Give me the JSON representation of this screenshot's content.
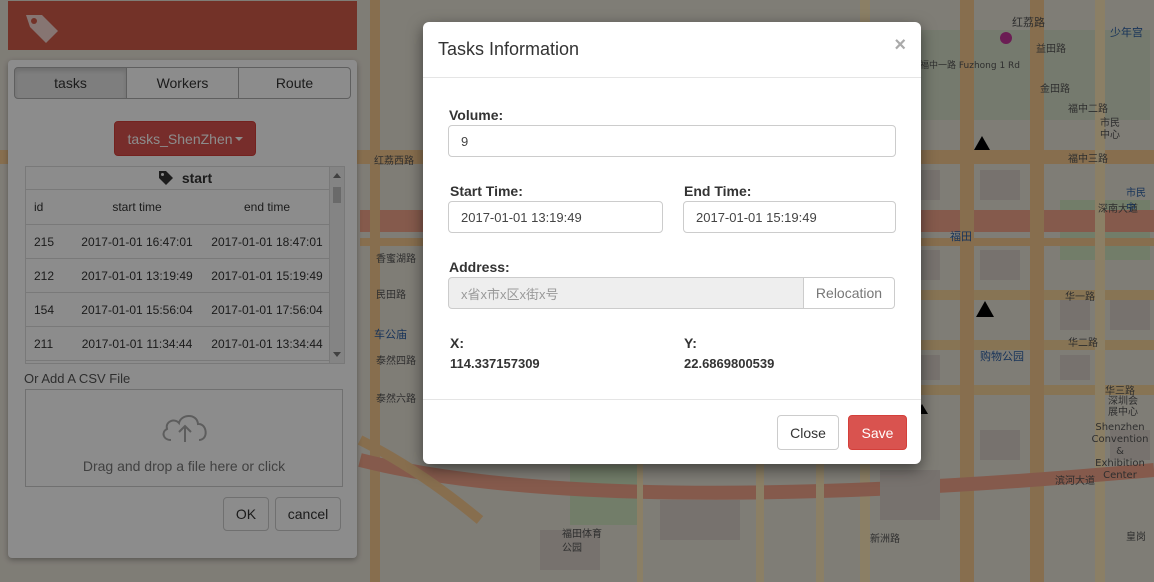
{
  "left_panel": {
    "tabs": [
      {
        "label": "tasks"
      },
      {
        "label": "Workers"
      },
      {
        "label": "Route"
      }
    ],
    "dataset_button": "tasks_ShenZhen",
    "table": {
      "title": "start",
      "headers": [
        "id",
        "start time",
        "end time"
      ],
      "rows": [
        {
          "id": "215",
          "start": "2017-01-01 16:47:01",
          "end": "2017-01-01 18:47:01"
        },
        {
          "id": "212",
          "start": "2017-01-01 13:19:49",
          "end": "2017-01-01 15:19:49"
        },
        {
          "id": "154",
          "start": "2017-01-01 15:56:04",
          "end": "2017-01-01 17:56:04"
        },
        {
          "id": "211",
          "start": "2017-01-01 11:34:44",
          "end": "2017-01-01 13:34:44"
        }
      ]
    },
    "csv_label": "Or Add A CSV File",
    "dropzone_text": "Drag and drop a file here or click",
    "ok_label": "OK",
    "cancel_label": "cancel"
  },
  "modal": {
    "title": "Tasks Information",
    "close_glyph": "×",
    "volume_label": "Volume:",
    "volume_value": "9",
    "start_label": "Start Time:",
    "start_value": "2017-01-01 13:19:49",
    "end_label": "End Time:",
    "end_value": "2017-01-01 15:19:49",
    "address_label": "Address:",
    "address_placeholder": "x省x市x区x街x号",
    "relocation_label": "Relocation",
    "x_label": "X:",
    "x_value": "114.337157309",
    "y_label": "Y:",
    "y_value": "22.6869800539",
    "close_label": "Close",
    "save_label": "Save"
  },
  "map": {
    "labels": [
      "红荔路",
      "少年宫",
      "福中一路 Fuzhong 1 Rd",
      "市民中心",
      "福中三路",
      "福中二路",
      "深南大道",
      "福田",
      "华一路",
      "购物公园",
      "华二路",
      "华三路",
      "深圳会展中心",
      "Shenzhen Convention & Exhibition Center",
      "滨河大道",
      "福田体育公园",
      "车公庙",
      "泰然四路",
      "泰然六路",
      "红荔西路",
      "香蜜湖路",
      "民田路",
      "益田路",
      "金田路",
      "新洲路",
      "皇岗",
      "市民中"
    ]
  },
  "colors": {
    "accent_red": "#d9534f",
    "topbar": "#d25b49"
  }
}
